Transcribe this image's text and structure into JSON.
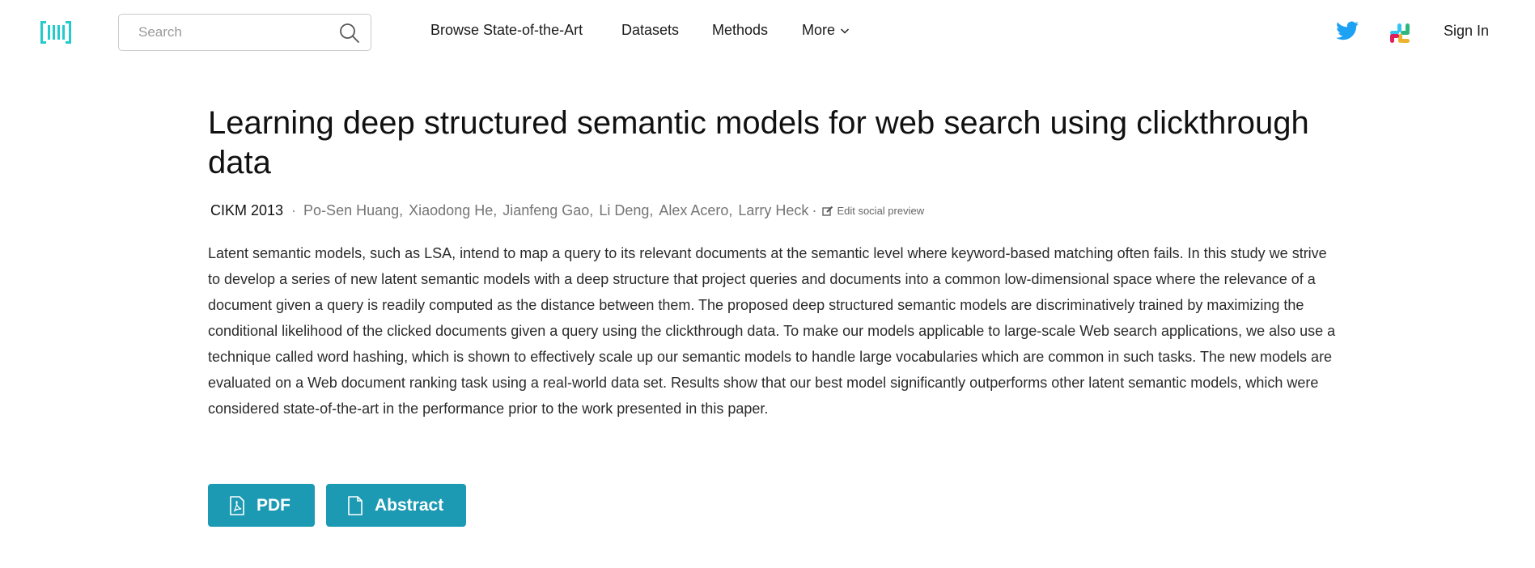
{
  "navbar": {
    "logo_icon": "papers-with-code-logo-icon",
    "search": {
      "placeholder": "Search",
      "value": "",
      "icon": "search-icon"
    },
    "links": {
      "browse": "Browse State-of-the-Art",
      "datasets": "Datasets",
      "methods": "Methods",
      "more": "More"
    },
    "more_icon": "chevron-down-icon",
    "social_icons": [
      "twitter-icon",
      "slack-icon"
    ],
    "sign_in": "Sign In"
  },
  "paper": {
    "title": "Learning deep structured semantic models for web search using clickthrough data",
    "venue": "CIKM 2013",
    "separator": "·",
    "authors": [
      "Po-Sen Huang",
      "Xiaodong He",
      "Jianfeng Gao",
      "Li Deng",
      "Alex Acero",
      "Larry Heck"
    ],
    "edit_social_preview": "Edit social preview",
    "abstract": "Latent semantic models, such as LSA, intend to map a query to its relevant documents at the semantic level where keyword-based matching often fails. In this study we strive to develop a series of new latent semantic models with a deep structure that project queries and documents into a common low-dimensional space where the relevance of a document given a query is readily computed as the distance between them. The proposed deep structured semantic models are discriminatively trained by maximizing the conditional likelihood of the clicked documents given a query using the clickthrough data. To make our models applicable to large-scale Web search applications, we also use a technique called word hashing, which is shown to effectively scale up our semantic models to handle large vocabularies which are common in such tasks. The new models are evaluated on a Web document ranking task using a real-world data set. Results show that our best model significantly outperforms other latent semantic models, which were considered state-of-the-art in the performance prior to the work presented in this paper."
  },
  "buttons": {
    "pdf": "PDF",
    "abstract": "Abstract"
  },
  "colors": {
    "brand_teal": "#21cbce",
    "button_blue": "#1c9ab3",
    "twitter_blue": "#1da1f2"
  }
}
